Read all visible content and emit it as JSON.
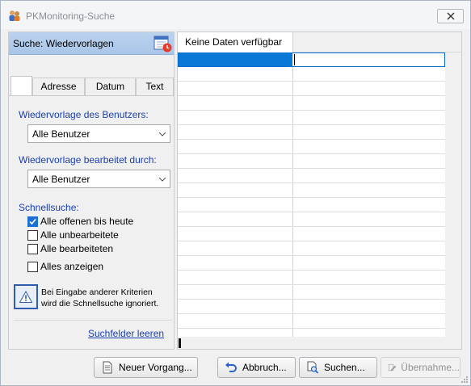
{
  "window": {
    "title": "PKMonitoring-Suche"
  },
  "panel": {
    "header": "Suche: Wiedervorlagen"
  },
  "tabs": [
    {
      "label": "Adresse"
    },
    {
      "label": "Datum"
    },
    {
      "label": "Text"
    }
  ],
  "filters": {
    "user_label": "Wiedervorlage des Benutzers:",
    "user_value": "Alle Benutzer",
    "edited_label": "Wiedervorlage bearbeitet durch:",
    "edited_value": "Alle Benutzer",
    "quick_label": "Schnellsuche:",
    "options": [
      {
        "label": "Alle offenen bis heute",
        "checked": true
      },
      {
        "label": "Alle unbearbeitete",
        "checked": false
      },
      {
        "label": "Alle bearbeiteten",
        "checked": false
      },
      {
        "label": "Alles anzeigen",
        "checked": false
      }
    ],
    "info_line1": "Bei Eingabe anderer Kriterien",
    "info_line2": "wird die Schnellsuche ignoriert.",
    "clear_link": "Suchfelder leeren"
  },
  "grid": {
    "header": "Keine Daten verfügbar"
  },
  "buttons": {
    "new": "Neuer Vorgang...",
    "cancel": "Abbruch...",
    "search": "Suchen...",
    "apply": "Übernahme..."
  },
  "colors": {
    "accent": "#0a78d7",
    "link": "#1a3fb0",
    "header_grad": "#bcd3ee"
  }
}
